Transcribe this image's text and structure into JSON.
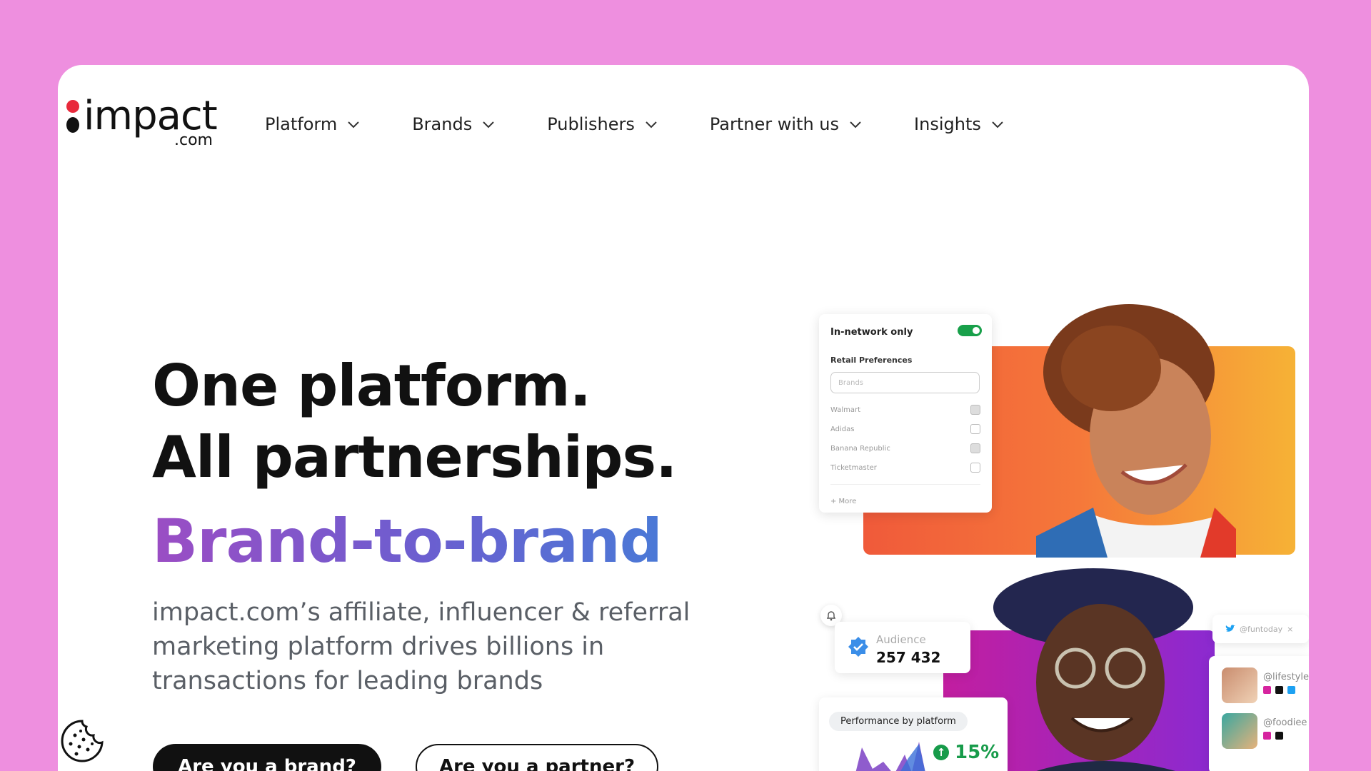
{
  "logo": {
    "word": "impact",
    "suffix": ".com"
  },
  "nav": {
    "items": [
      {
        "label": "Platform"
      },
      {
        "label": "Brands"
      },
      {
        "label": "Publishers"
      },
      {
        "label": "Partner with us"
      },
      {
        "label": "Insights"
      }
    ]
  },
  "hero": {
    "headline_line1": "One platform.",
    "headline_line2": "All partnerships.",
    "rotating_subhead": "Brand-to-brand",
    "description": "impact.com’s affiliate, influencer & referral marketing platform drives billions in transactions for leading brands",
    "primary_cta": "Are you a brand?",
    "secondary_cta": "Are you a partner?"
  },
  "filter_card": {
    "toggle_label": "In-network only",
    "toggle_on": true,
    "section_title": "Retail Preferences",
    "search_placeholder": "Brands",
    "brands": [
      {
        "name": "Walmart",
        "checked": true
      },
      {
        "name": "Adidas",
        "checked": false
      },
      {
        "name": "Banana Republic",
        "checked": true
      },
      {
        "name": "Ticketmaster",
        "checked": false
      }
    ],
    "more_label": "+ More"
  },
  "audience_card": {
    "label": "Audience",
    "value": "257 432"
  },
  "performance_card": {
    "label": "Performance by platform",
    "change": "15%"
  },
  "social_card": {
    "handle": "@funtoday",
    "close": "×"
  },
  "profiles": [
    {
      "handle": "@lifestyle"
    },
    {
      "handle": "@foodiee"
    }
  ],
  "colors": {
    "page_bg": "#ee8fdf",
    "accent_green": "#179b4a",
    "subhead_gradient_start": "#9b4dc4",
    "subhead_gradient_end": "#4a79d6",
    "logo_red": "#e8293b"
  }
}
